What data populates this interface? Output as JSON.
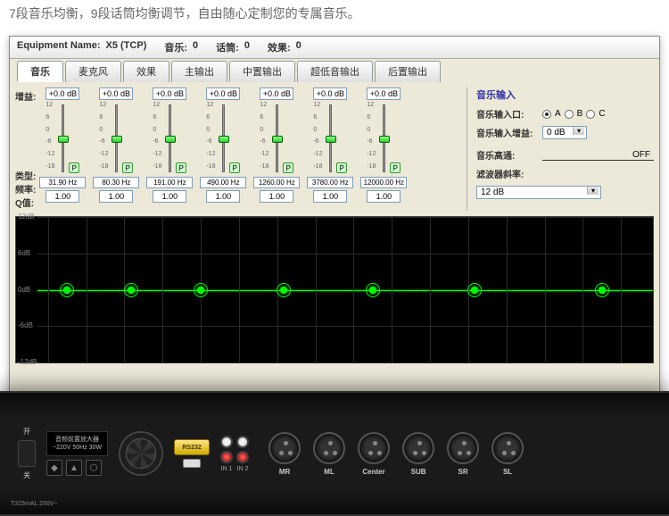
{
  "header": "7段音乐均衡，9段话筒均衡调节，自由随心定制您的专属音乐。",
  "info_bar": {
    "equipment_name_label": "Equipment Name:",
    "equipment_name": "X5 (TCP)",
    "music_label": "音乐:",
    "music_val": "0",
    "speech_label": "话筒:",
    "speech_val": "0",
    "effect_label": "效果:",
    "effect_val": "0"
  },
  "tabs": [
    "音乐",
    "麦克风",
    "效果",
    "主输出",
    "中置输出",
    "超低音输出",
    "后置输出"
  ],
  "active_tab": 0,
  "row_labels": {
    "gain": "增益:",
    "type": "类型:",
    "freq": "频率:",
    "q": "Q值:"
  },
  "eq_bands": [
    {
      "gain": "+0.0 dB",
      "freq": "31.90 Hz",
      "q": "1.00"
    },
    {
      "gain": "+0.0 dB",
      "freq": "80.30 Hz",
      "q": "1.00"
    },
    {
      "gain": "+0.0 dB",
      "freq": "191.00 Hz",
      "q": "1.00"
    },
    {
      "gain": "+0.0 dB",
      "freq": "490.00 Hz",
      "q": "1.00"
    },
    {
      "gain": "+0.0 dB",
      "freq": "1260.00 Hz",
      "q": "1.00"
    },
    {
      "gain": "+0.0 dB",
      "freq": "3780.00 Hz",
      "q": "1.00"
    },
    {
      "gain": "+0.0 dB",
      "freq": "12000.00 Hz",
      "q": "1.00"
    }
  ],
  "slider_scale": [
    "12",
    "6",
    "0",
    "-6",
    "-12",
    "-18"
  ],
  "right_panel": {
    "title": "音乐输入",
    "input_port_label": "音乐输入口:",
    "port_a": "A",
    "port_b": "B",
    "port_c": "C",
    "input_gain_label": "音乐输入增益:",
    "input_gain": "0 dB",
    "highpass_label": "音乐高通:",
    "highpass": "OFF",
    "filter_slope_label": "滤波器斜率:",
    "filter_slope": "12 dB"
  },
  "graph": {
    "y_labels": [
      "12dB",
      "6dB",
      "0dB",
      "-6dB",
      "-12dB"
    ],
    "nodes_x_pct": [
      8,
      18,
      29,
      42,
      56,
      72,
      92
    ]
  },
  "hardware": {
    "power_on": "开",
    "power_off": "关",
    "amp_label_line1": "音频前置放大器",
    "amp_label_line2": "~220V 50Hz 30W",
    "spec": "T315mAL\n250V~",
    "rs232": "RS232",
    "rca": [
      "IN 1",
      "IN 2"
    ],
    "xlr": [
      "MR",
      "ML",
      "Center",
      "SUB",
      "SR",
      "SL"
    ]
  }
}
